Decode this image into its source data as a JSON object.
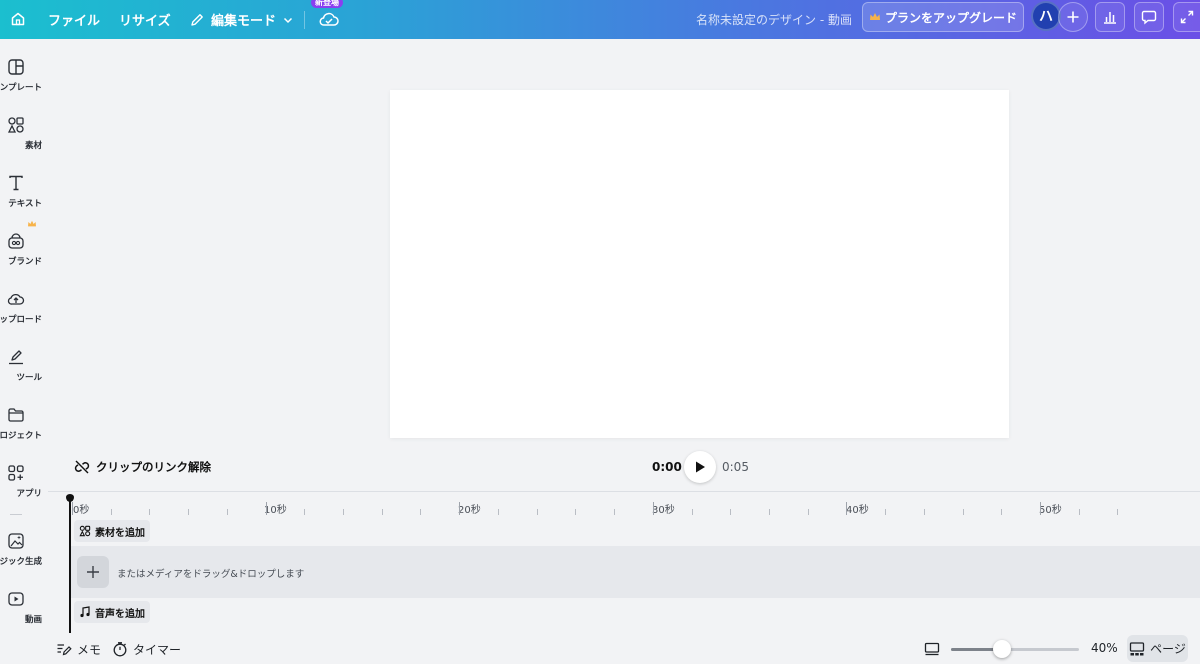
{
  "topbar": {
    "file_label": "ファイル",
    "resize_label": "リサイズ",
    "edit_mode_label": "編集モード",
    "new_badge": "新登場",
    "design_title": "名称未設定のデザイン - 動画",
    "upgrade_label": "プランをアップグレード",
    "avatar_initial": "ハ",
    "gradient_colors": [
      "#1bbfcf",
      "#2aa3d6",
      "#4a78e0",
      "#6b4fe6"
    ]
  },
  "sidebar": {
    "items": [
      {
        "label": "ンプレート",
        "icon": "template-icon"
      },
      {
        "label": "素材",
        "icon": "elements-icon"
      },
      {
        "label": "テキスト",
        "icon": "text-icon"
      },
      {
        "label": "ブランド",
        "icon": "brand-icon",
        "premium": true
      },
      {
        "label": "ップロード",
        "icon": "upload-icon"
      },
      {
        "label": "ツール",
        "icon": "draw-icon"
      },
      {
        "label": "ロジェクト",
        "icon": "folder-icon"
      },
      {
        "label": "アプリ",
        "icon": "apps-icon"
      },
      {
        "label": "ジック生成",
        "icon": "magic-media-icon"
      },
      {
        "label": "動画",
        "icon": "video-icon"
      }
    ]
  },
  "playback": {
    "unlink_label": "クリップのリンク解除",
    "current_time": "0:00",
    "total_time": "0:05"
  },
  "timeline": {
    "ruler_labels": [
      "0秒",
      "10秒",
      "20秒",
      "30秒",
      "40秒",
      "50秒"
    ],
    "add_elements_label": "素材を追加",
    "drop_hint": "またはメディアをドラッグ&ドロップします",
    "add_audio_label": "音声を追加"
  },
  "bottombar": {
    "notes_label": "メモ",
    "timer_label": "タイマー",
    "zoom_percent": "40%",
    "zoom_level": 0.4,
    "pages_label": "ページ"
  }
}
